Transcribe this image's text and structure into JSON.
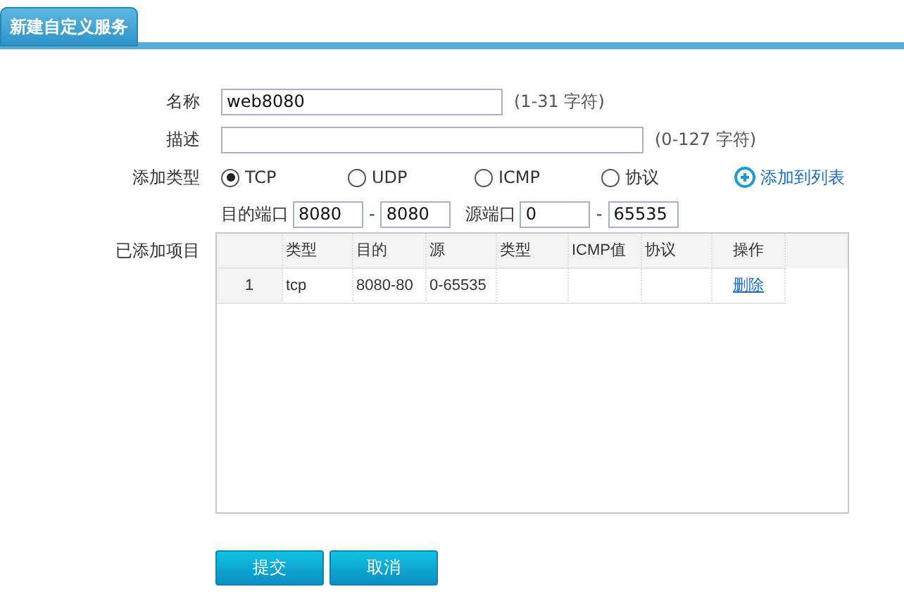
{
  "tab": {
    "title": "新建自定义服务"
  },
  "name": {
    "label": "名称",
    "value": "web8080",
    "hint": "(1-31 字符)"
  },
  "description": {
    "label": "描述",
    "hint": "(0-127 字符)"
  },
  "add_type": {
    "label": "添加类型",
    "options": [
      {
        "label": "TCP",
        "selected": true
      },
      {
        "label": "UDP",
        "selected": false
      },
      {
        "label": "ICMP",
        "selected": false
      },
      {
        "label": "协议",
        "selected": false
      }
    ],
    "add_link": "添加到列表"
  },
  "ports": {
    "dest_label": "目的端口",
    "dest_from": "8080",
    "dest_sep": "-",
    "dest_to": "8080",
    "src_label": "源端口",
    "src_from": "0",
    "src_sep": "-",
    "src_to": "65535"
  },
  "table": {
    "label": "已添加项目",
    "columns": [
      "",
      "类型",
      "目的",
      "源",
      "类型",
      "ICMP值",
      "协议",
      "操作"
    ],
    "rows": [
      {
        "cells": [
          "1",
          "tcp",
          "8080-80",
          "0-65535",
          "",
          "",
          "",
          ""
        ],
        "action": "删除"
      }
    ]
  },
  "buttons": [
    "提交",
    "取消"
  ]
}
